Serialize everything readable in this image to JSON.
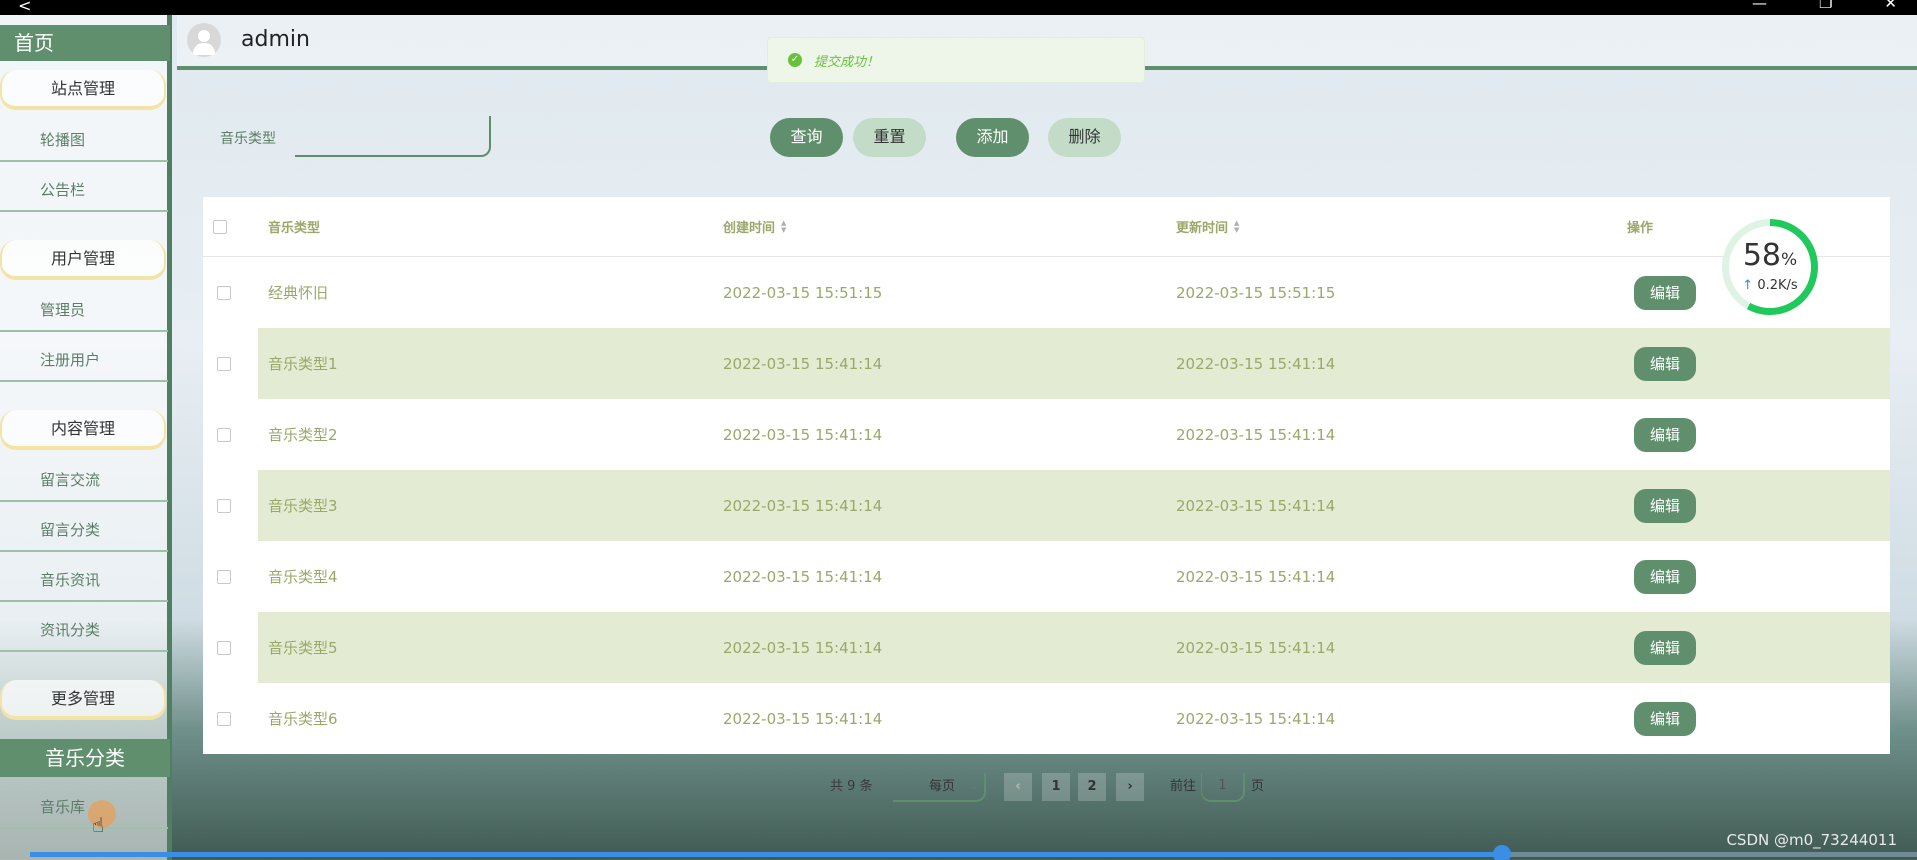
{
  "window": {
    "back_glyph": "<",
    "controls": [
      "—",
      "❐",
      "✕"
    ]
  },
  "header": {
    "username": "admin"
  },
  "toast": {
    "message": "提交成功！",
    "icon": "check-circle-icon"
  },
  "sidebar": {
    "home": "首页",
    "site_mgmt": "站点管理",
    "carousel": "轮播图",
    "notice": "公告栏",
    "user_mgmt": "用户管理",
    "admin": "管理员",
    "registered_users": "注册用户",
    "content_mgmt": "内容管理",
    "messages": "留言交流",
    "message_category": "留言分类",
    "music_news": "音乐资讯",
    "news_category": "资讯分类",
    "more_mgmt": "更多管理",
    "music_category": "音乐分类",
    "music_library": "音乐库"
  },
  "search": {
    "label": "音乐类型",
    "value": ""
  },
  "buttons": {
    "query": "查询",
    "reset": "重置",
    "add": "添加",
    "delete": "删除"
  },
  "table": {
    "headers": {
      "type": "音乐类型",
      "created": "创建时间",
      "updated": "更新时间",
      "action": "操作"
    },
    "edit_label": "编辑",
    "rows": [
      {
        "type": "经典怀旧",
        "created": "2022-03-15 15:51:15",
        "updated": "2022-03-15 15:51:15"
      },
      {
        "type": "音乐类型1",
        "created": "2022-03-15 15:41:14",
        "updated": "2022-03-15 15:41:14"
      },
      {
        "type": "音乐类型2",
        "created": "2022-03-15 15:41:14",
        "updated": "2022-03-15 15:41:14"
      },
      {
        "type": "音乐类型3",
        "created": "2022-03-15 15:41:14",
        "updated": "2022-03-15 15:41:14"
      },
      {
        "type": "音乐类型4",
        "created": "2022-03-15 15:41:14",
        "updated": "2022-03-15 15:41:14"
      },
      {
        "type": "音乐类型5",
        "created": "2022-03-15 15:41:14",
        "updated": "2022-03-15 15:41:14"
      },
      {
        "type": "音乐类型6",
        "created": "2022-03-15 15:41:14",
        "updated": "2022-03-15 15:41:14"
      }
    ]
  },
  "gauge": {
    "percent": "58",
    "percent_unit": "%",
    "speed": "0.2K/s"
  },
  "pagination": {
    "total": "共 9 条",
    "page_size": "每页",
    "prev": "‹",
    "pages": [
      "1",
      "2"
    ],
    "next": "›",
    "goto": "前往",
    "goto_value": "1",
    "page_unit": "页"
  },
  "video_progress": 0.78,
  "watermark": "CSDN @m0_73244011"
}
